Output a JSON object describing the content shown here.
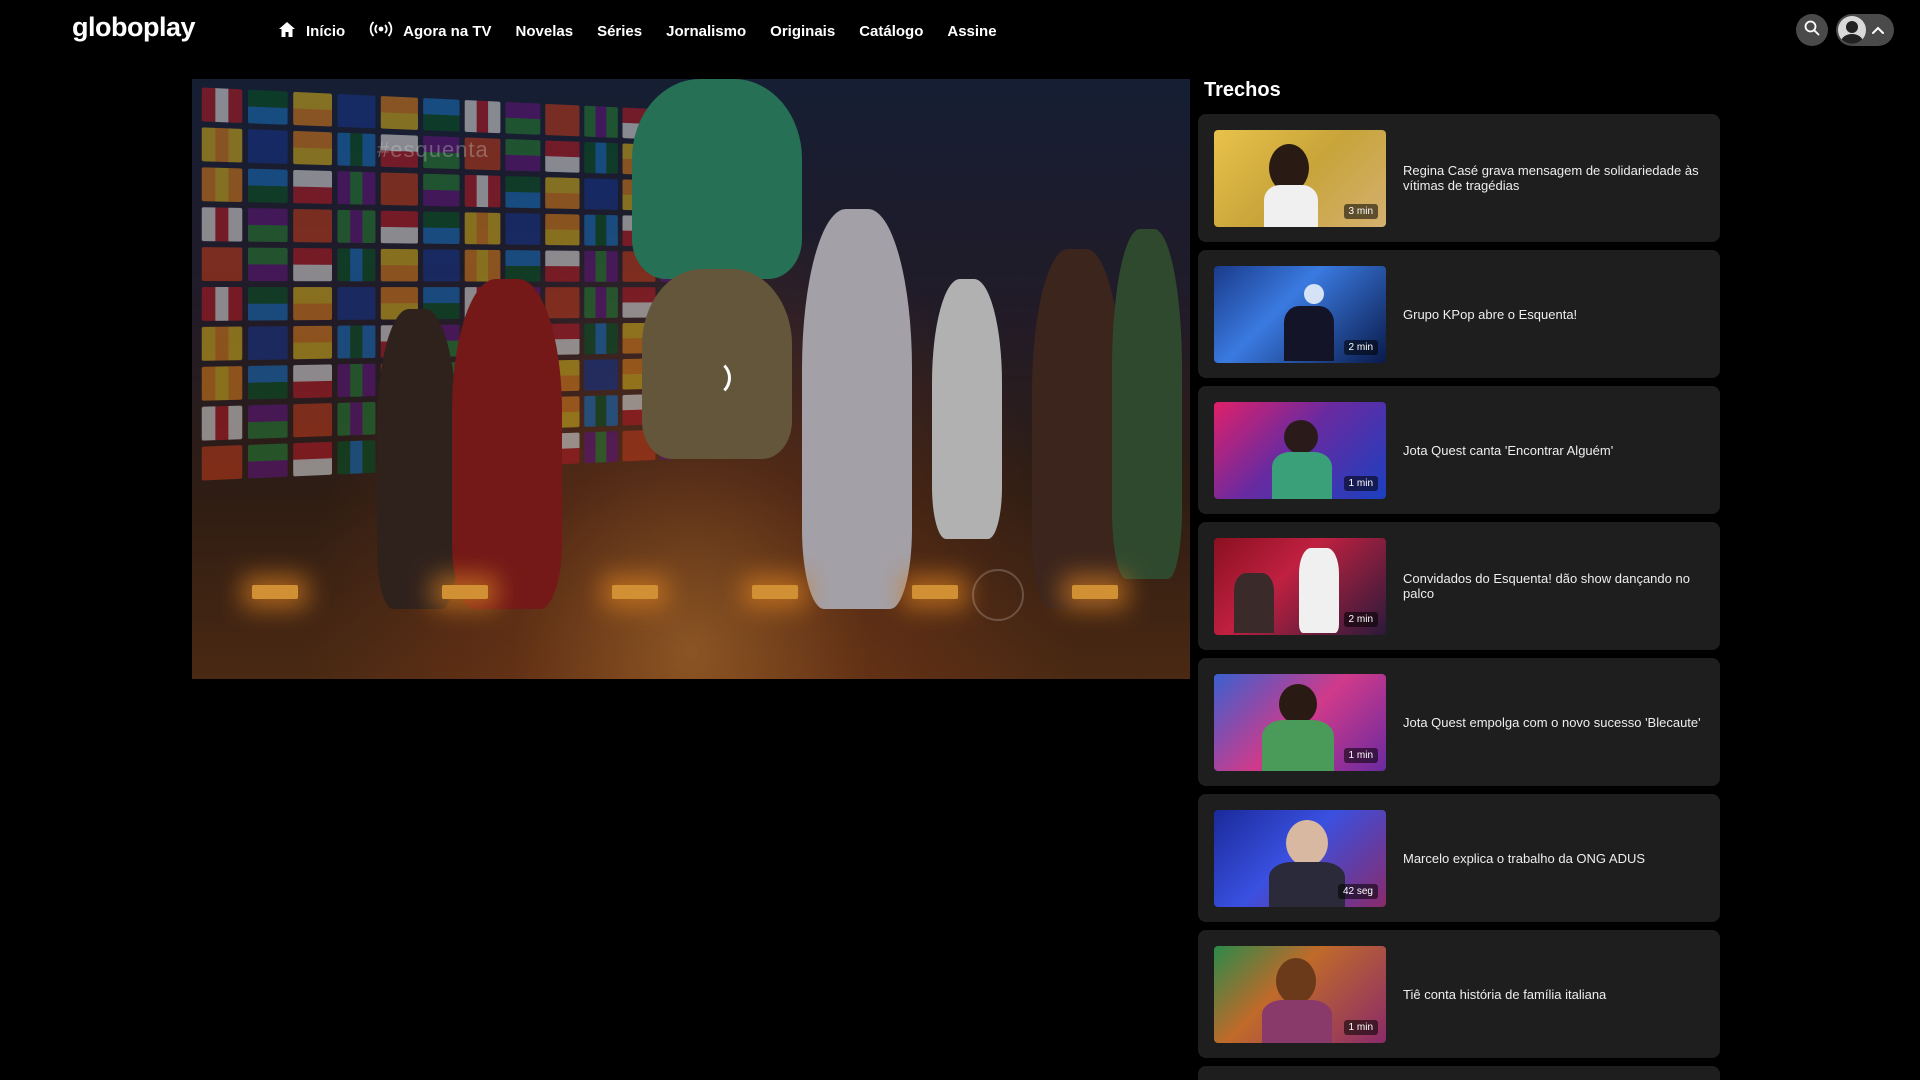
{
  "header": {
    "logo": "globoplay",
    "nav": [
      {
        "label": "Início",
        "icon": "home-icon"
      },
      {
        "label": "Agora na TV",
        "icon": "live-broadcast-icon"
      },
      {
        "label": "Novelas"
      },
      {
        "label": "Séries"
      },
      {
        "label": "Jornalismo"
      },
      {
        "label": "Originais"
      },
      {
        "label": "Catálogo"
      },
      {
        "label": "Assine"
      }
    ],
    "search_icon": "search-icon",
    "profile_icon": "user-avatar-icon",
    "menu_icon": "chevron-up-icon"
  },
  "player": {
    "overlay_text": "#esquenta",
    "state": "loading"
  },
  "sidebar": {
    "title": "Trechos",
    "items": [
      {
        "title": "Regina Casé grava mensagem de solidariedade às vítimas de tragédias",
        "duration": "3 min"
      },
      {
        "title": "Grupo KPop abre o Esquenta!",
        "duration": "2 min"
      },
      {
        "title": "Jota Quest canta 'Encontrar Alguém'",
        "duration": "1 min"
      },
      {
        "title": "Convidados do Esquenta! dão show dançando no palco",
        "duration": "2 min"
      },
      {
        "title": "Jota Quest empolga com o novo sucesso 'Blecaute'",
        "duration": "1 min"
      },
      {
        "title": "Marcelo explica o trabalho da ONG ADUS",
        "duration": "42 seg"
      },
      {
        "title": "Tiê conta história de família italiana",
        "duration": "1 min"
      }
    ]
  },
  "colors": {
    "background": "#000000",
    "card": "#1e1e1e",
    "button": "#4a4a4a",
    "text": "#ffffff"
  }
}
